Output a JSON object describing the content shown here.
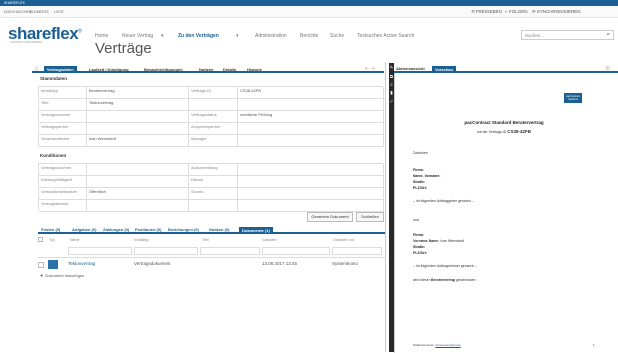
{
  "app": {
    "brand": "shareflex",
    "tagline": "CONTRACT MANAGEMENT",
    "topbar_label": "SHAREFLEX",
    "page_title": "Verträge"
  },
  "ribbon": {
    "tabs": [
      "DURCHSUCHEN",
      "ELEMENTE",
      "LISTE"
    ]
  },
  "page_actions": {
    "share": "FREIGEBEN",
    "follow": "FOLGEN",
    "sync": "SYNCHRONISIEREN"
  },
  "nav": {
    "items": [
      "Home",
      "Neuer Vertrag",
      "Zu den Verträgen",
      "Administration",
      "Berichte",
      "Suche",
      "Testsuchen Active Search"
    ]
  },
  "search": {
    "placeholder": "Suchen..."
  },
  "detail": {
    "tabs": [
      "Vertragsdaten",
      "Laufzeit / Kündigung",
      "Benachrichtigungen",
      "Notizen",
      "Details",
      "Historie"
    ],
    "stammdaten": {
      "heading": "Stammdaten",
      "rows": [
        {
          "l1": "Inhaltstyp",
          "v1": "Beratervertrag",
          "l2": "Vertrags-ID",
          "v2": "CS38-42FB"
        },
        {
          "l1": "Titel",
          "v1": "Tektonvertrag",
          "l2": "",
          "v2": ""
        },
        {
          "l1": "Vertragsnummer",
          "v1": "",
          "l2": "Vertragsstatus",
          "v2": "rechtliche Prüfung"
        },
        {
          "l1": "Vertragspartner",
          "v1": "",
          "l2": "Ansprechpartner",
          "v2": ""
        },
        {
          "l1": "Verantwortlicher",
          "v1": "Ivan Wernstedt",
          "l2": "Manager",
          "v2": ""
        }
      ]
    },
    "konditionen": {
      "heading": "Konditionen",
      "rows": [
        {
          "l1": "Vertragsvolumen",
          "v1": "",
          "l2": "Ausschreibung",
          "v2": ""
        },
        {
          "l1": "Zahlungsfälligkeit",
          "v1": "",
          "l2": "Rabatt",
          "v2": ""
        },
        {
          "l1": "Vertraulichkeitsstufe",
          "v1": "Öffentlich",
          "l2": "Skonto",
          "v2": ""
        },
        {
          "l1": "Vertragsbeweis",
          "v1": "",
          "l2": "",
          "v2": ""
        }
      ]
    },
    "buttons": {
      "generate": "Generiere Dokument",
      "close": "Schließen"
    }
  },
  "related": {
    "tabs": [
      "Fristen (0)",
      "Aufgaben (0)",
      "Zahlungen (0)",
      "Positionen (0)",
      "Beziehungen (0)",
      "Notizen (0)",
      "Dokumente (1)"
    ],
    "columns": [
      "Typ",
      "Name",
      "Inhaltstyp",
      "Titel",
      "Geändert",
      "Geändert von"
    ],
    "row": {
      "name": "Tektonvertrag",
      "type": "Vertragsdokument",
      "modified": "13.06.2017 13:45",
      "modified_by": "Systemkonto"
    },
    "new_doc": "Dokument hinzufügen"
  },
  "preview": {
    "tabs": [
      "Aktionsansicht",
      "Vorschau"
    ],
    "doc_title": "pacContract Standard Beratervertrag",
    "doc_subtitle": "mit der Vertrags-ID",
    "doc_id": "CS38-42FB",
    "logo": "pacContract Systems",
    "zwischen": "Zwischen",
    "firma_block": [
      "Firma:",
      "Name, Vorname:",
      "Straße:",
      "PLZ/Ort:"
    ],
    "auftraggeber": "– im folgenden Auftraggeber genannt –",
    "und": "und",
    "firma2_block": [
      "Firma:",
      "Vorname Name:",
      "Straße:",
      "PLZ/Ort:"
    ],
    "firma2_name": "Ivan Wernstedt",
    "auftragnehmer": "– im folgenden Auftragnehmer genannt –",
    "beraterpart1": "wird dieser",
    "beraterpart2": "Beratervertrag",
    "beraterpart3": "geschlossen:",
    "footer_label": "Telefonnummer:",
    "footer_link": "www.pacontract.de",
    "page_no": "1"
  }
}
